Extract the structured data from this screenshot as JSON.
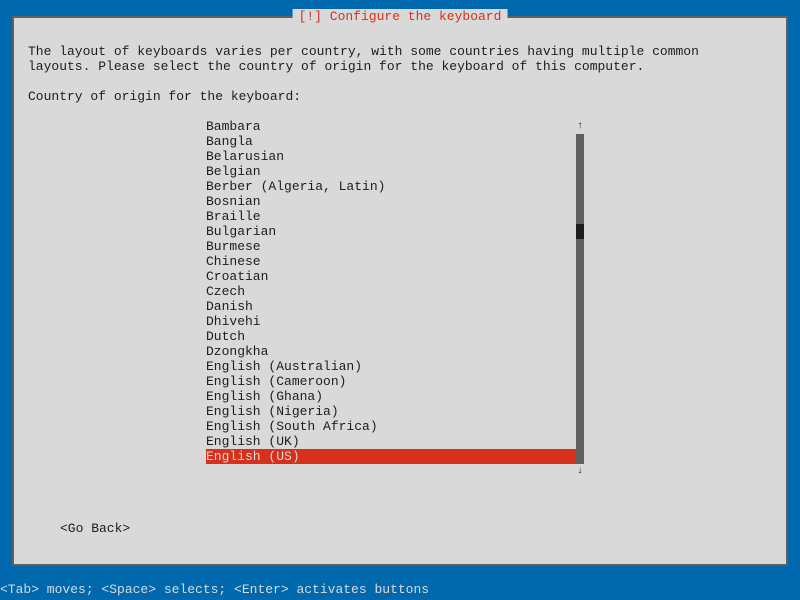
{
  "dialog": {
    "title": "[!] Configure the keyboard",
    "instructions": "The layout of keyboards varies per country, with some countries having multiple common\nlayouts. Please select the country of origin for the keyboard of this computer.",
    "prompt": "Country of origin for the keyboard:",
    "go_back": "<Go Back>"
  },
  "list": {
    "items": [
      "Bambara",
      "Bangla",
      "Belarusian",
      "Belgian",
      "Berber (Algeria, Latin)",
      "Bosnian",
      "Braille",
      "Bulgarian",
      "Burmese",
      "Chinese",
      "Croatian",
      "Czech",
      "Danish",
      "Dhivehi",
      "Dutch",
      "Dzongkha",
      "English (Australian)",
      "English (Cameroon)",
      "English (Ghana)",
      "English (Nigeria)",
      "English (South Africa)",
      "English (UK)",
      "English (US)"
    ],
    "selected_index": 22
  },
  "scroll": {
    "up_arrow": "↑",
    "down_arrow": "↓"
  },
  "footer": "<Tab> moves; <Space> selects; <Enter> activates buttons"
}
